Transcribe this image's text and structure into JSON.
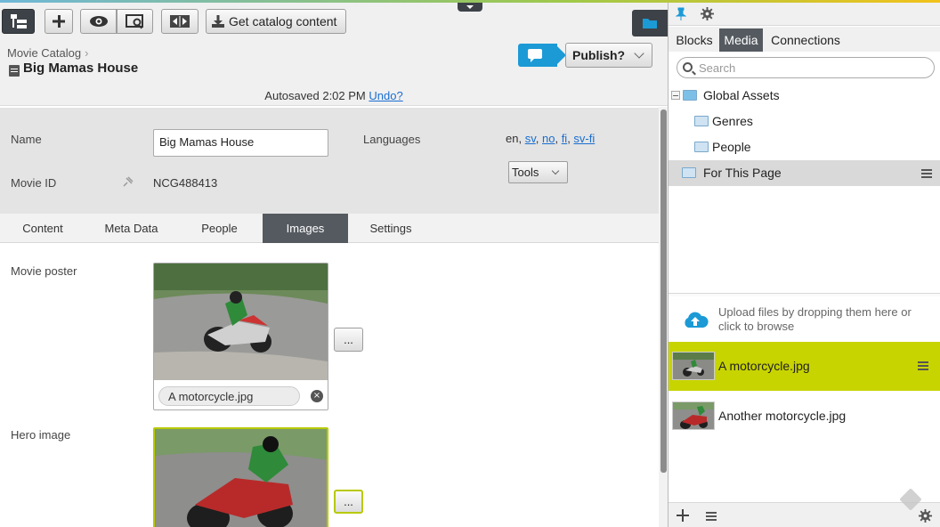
{
  "toolbar": {
    "get_catalog_label": "Get catalog content"
  },
  "header": {
    "breadcrumb": "Movie Catalog",
    "page_title": "Big Mamas House",
    "publish_label": "Publish?",
    "autosave_text": "Autosaved 2:02 PM",
    "undo_link": "Undo?"
  },
  "properties": {
    "name_label": "Name",
    "name_value": "Big Mamas House",
    "movie_id_label": "Movie ID",
    "movie_id_value": "NCG488413",
    "languages_label": "Languages",
    "current_language": "en,",
    "language_links": [
      "sv",
      "no",
      "fi",
      "sv-fi"
    ],
    "tools_label": "Tools"
  },
  "tabs": [
    "Content",
    "Meta Data",
    "People",
    "Images",
    "Settings"
  ],
  "active_tab": "Images",
  "images": {
    "poster_label": "Movie poster",
    "poster_file": "A motorcycle.jpg",
    "hero_label": "Hero image",
    "browse_label": "...",
    "remove_glyph": "×"
  },
  "pane": {
    "tabs": [
      "Blocks",
      "Media",
      "Connections"
    ],
    "active_tab": "Media",
    "search_placeholder": "Search",
    "tree": [
      "Global Assets",
      "Genres",
      "People",
      "For This Page"
    ],
    "upload_text": "Upload files by dropping them here or click to browse",
    "media_items": [
      "A motorcycle.jpg",
      "Another motorcycle.jpg"
    ]
  },
  "colors": {
    "accent_blue": "#1c9ad6",
    "selection_lime": "#c8d400",
    "dark_tab": "#555a60"
  }
}
